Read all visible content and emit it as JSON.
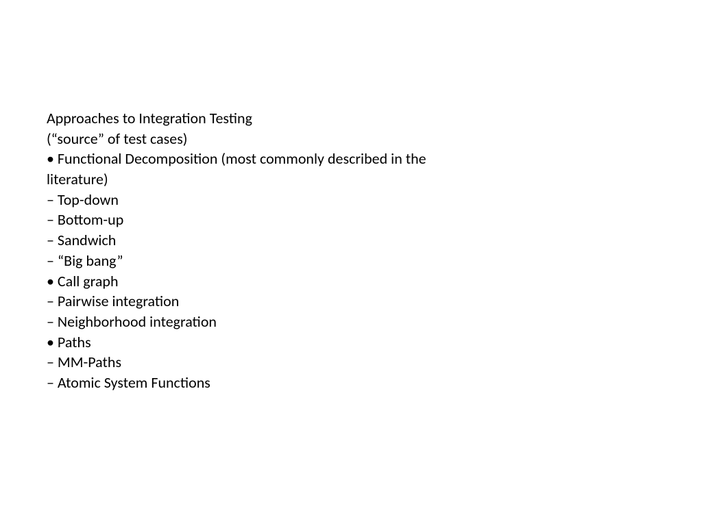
{
  "slide": {
    "lines": [
      "Approaches to Integration Testing",
      "(“source” of test cases)",
      "• Functional Decomposition (most commonly described in the literature)",
      "– Top-down",
      "– Bottom-up",
      "– Sandwich",
      "– “Big bang”",
      "• Call graph",
      "– Pairwise integration",
      "– Neighborhood integration",
      "• Paths",
      "– MM-Paths",
      "– Atomic System Functions"
    ]
  }
}
